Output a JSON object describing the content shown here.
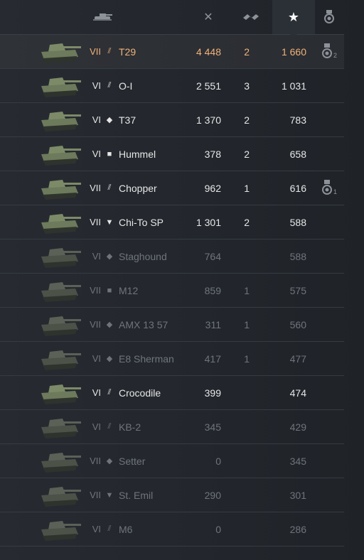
{
  "header": {
    "vehicle_icon": "tank-icon",
    "battles_icon": "crossed-swords-icon",
    "wins_icon": "wins-icon",
    "score_icon": "star-icon",
    "medal_icon": "medal-icon",
    "sorted_by": "score"
  },
  "rows": [
    {
      "tier": "VII",
      "cls": "heavy",
      "name": "T29",
      "battles": "4 448",
      "wins": "2",
      "score": "1 660",
      "medal": "2",
      "style": "gold",
      "highlight": true
    },
    {
      "tier": "VI",
      "cls": "heavy",
      "name": "O-I",
      "battles": "2 551",
      "wins": "3",
      "score": "1 031",
      "medal": "",
      "style": "white",
      "highlight": false
    },
    {
      "tier": "VI",
      "cls": "medium",
      "name": "T37",
      "battles": "1 370",
      "wins": "2",
      "score": "783",
      "medal": "",
      "style": "white",
      "highlight": false
    },
    {
      "tier": "VI",
      "cls": "spg",
      "name": "Hummel",
      "battles": "378",
      "wins": "2",
      "score": "658",
      "medal": "",
      "style": "white",
      "highlight": false
    },
    {
      "tier": "VII",
      "cls": "heavy",
      "name": "Chopper",
      "battles": "962",
      "wins": "1",
      "score": "616",
      "medal": "1",
      "style": "white",
      "highlight": false
    },
    {
      "tier": "VII",
      "cls": "td",
      "name": "Chi-To SP",
      "battles": "1 301",
      "wins": "2",
      "score": "588",
      "medal": "",
      "style": "white",
      "highlight": false
    },
    {
      "tier": "VI",
      "cls": "medium",
      "name": "Staghound",
      "battles": "764",
      "wins": "",
      "score": "588",
      "medal": "",
      "style": "dim",
      "highlight": false
    },
    {
      "tier": "VII",
      "cls": "spg",
      "name": "M12",
      "battles": "859",
      "wins": "1",
      "score": "575",
      "medal": "",
      "style": "dim",
      "highlight": false
    },
    {
      "tier": "VII",
      "cls": "medium",
      "name": "AMX 13 57",
      "battles": "311",
      "wins": "1",
      "score": "560",
      "medal": "",
      "style": "dim",
      "highlight": false
    },
    {
      "tier": "VI",
      "cls": "medium",
      "name": "E8 Sherman",
      "battles": "417",
      "wins": "1",
      "score": "477",
      "medal": "",
      "style": "dim",
      "highlight": false
    },
    {
      "tier": "VI",
      "cls": "heavy",
      "name": "Crocodile",
      "battles": "399",
      "wins": "",
      "score": "474",
      "medal": "",
      "style": "white",
      "highlight": false
    },
    {
      "tier": "VI",
      "cls": "heavy",
      "name": "KB-2",
      "battles": "345",
      "wins": "",
      "score": "429",
      "medal": "",
      "style": "dim",
      "highlight": false
    },
    {
      "tier": "VII",
      "cls": "medium",
      "name": "Setter",
      "battles": "0",
      "wins": "",
      "score": "345",
      "medal": "",
      "style": "dim",
      "highlight": false
    },
    {
      "tier": "VII",
      "cls": "td",
      "name": "St. Emil",
      "battles": "290",
      "wins": "",
      "score": "301",
      "medal": "",
      "style": "dim",
      "highlight": false
    },
    {
      "tier": "VI",
      "cls": "heavy",
      "name": "M6",
      "battles": "0",
      "wins": "",
      "score": "286",
      "medal": "",
      "style": "dim",
      "highlight": false
    }
  ]
}
